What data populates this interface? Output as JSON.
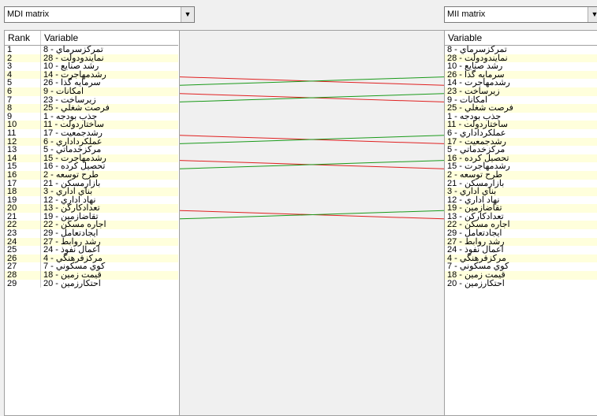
{
  "left_selector": {
    "value": "MDI matrix",
    "icon": "chevron-down-icon"
  },
  "right_selector": {
    "value": "MII matrix",
    "icon": "chevron-down-icon"
  },
  "left_table": {
    "headers": {
      "rank": "Rank",
      "variable": "Variable"
    },
    "rows": [
      {
        "rank": "1",
        "variable": "تمركزسرماي - 8"
      },
      {
        "rank": "2",
        "variable": "نمايندودولت - 28"
      },
      {
        "rank": "3",
        "variable": "رشد صنايع - 10"
      },
      {
        "rank": "4",
        "variable": "رشدمهاجرت - 14"
      },
      {
        "rank": "5",
        "variable": "سرمايه گذا - 26"
      },
      {
        "rank": "6",
        "variable": "امكانات - 9"
      },
      {
        "rank": "7",
        "variable": "زيرساخت - 23"
      },
      {
        "rank": "8",
        "variable": "فرصت شغلي - 25"
      },
      {
        "rank": "9",
        "variable": "جذب بودجه - 1"
      },
      {
        "rank": "10",
        "variable": "ساختاردولت - 11"
      },
      {
        "rank": "11",
        "variable": "رشدجمعيت - 17"
      },
      {
        "rank": "12",
        "variable": "عملكرداداري - 6"
      },
      {
        "rank": "13",
        "variable": "مركزخدماتي - 5"
      },
      {
        "rank": "14",
        "variable": "رشدمهاجرت - 15"
      },
      {
        "rank": "15",
        "variable": "تحصيل كرده - 16"
      },
      {
        "rank": "16",
        "variable": "طرح توسعه - 2"
      },
      {
        "rank": "17",
        "variable": "بازارمسكن - 21"
      },
      {
        "rank": "18",
        "variable": "بناي اداري - 3"
      },
      {
        "rank": "19",
        "variable": "نهاد اداري - 12"
      },
      {
        "rank": "20",
        "variable": "تعدادكاركن - 13"
      },
      {
        "rank": "21",
        "variable": "تقاضازمين - 19"
      },
      {
        "rank": "22",
        "variable": "اجاره مسكن - 22"
      },
      {
        "rank": "23",
        "variable": "ايجادتعامل - 29"
      },
      {
        "rank": "24",
        "variable": "رشد روابط - 27"
      },
      {
        "rank": "25",
        "variable": "اعمال نفوذ - 24"
      },
      {
        "rank": "26",
        "variable": "مركزفرهنگي - 4"
      },
      {
        "rank": "27",
        "variable": "كوي مسكوني - 7"
      },
      {
        "rank": "28",
        "variable": "قيمت زمين - 18"
      },
      {
        "rank": "29",
        "variable": "احتكارزمين - 20"
      }
    ]
  },
  "right_table": {
    "header": "Variable",
    "rows": [
      "تمركزسرماي - 8",
      "نمايندودولت - 28",
      "رشد صنايع - 10",
      "سرمايه گذا - 26",
      "رشدمهاجرت - 14",
      "زيرساخت - 23",
      "امكانات - 9",
      "فرصت شغلي - 25",
      "جذب بودجه - 1",
      "ساختاردولت - 11",
      "عملكرداداري - 6",
      "رشدجمعيت - 17",
      "مركزخدماتي - 5",
      "تحصيل كرده - 16",
      "رشدمهاجرت - 15",
      "طرح توسعه - 2",
      "بازارمسكن - 21",
      "بناي اداري - 3",
      "نهاد اداري - 12",
      "تقاضازمين - 19",
      "تعدادكاركن - 13",
      "اجاره مسكن - 22",
      "ايجادتعامل - 29",
      "رشد روابط - 27",
      "اعمال نفوذ - 24",
      "مركزفرهنگي - 4",
      "كوي مسكوني - 7",
      "قيمت زمين - 18",
      "احتكارزمين - 20"
    ]
  },
  "rank_changes": [
    {
      "from_rank": 4,
      "to_rank": 5,
      "color": "#e02020"
    },
    {
      "from_rank": 5,
      "to_rank": 4,
      "color": "#1a9a1a"
    },
    {
      "from_rank": 6,
      "to_rank": 7,
      "color": "#e02020"
    },
    {
      "from_rank": 7,
      "to_rank": 6,
      "color": "#1a9a1a"
    },
    {
      "from_rank": 11,
      "to_rank": 12,
      "color": "#e02020"
    },
    {
      "from_rank": 12,
      "to_rank": 11,
      "color": "#1a9a1a"
    },
    {
      "from_rank": 14,
      "to_rank": 15,
      "color": "#e02020"
    },
    {
      "from_rank": 15,
      "to_rank": 14,
      "color": "#1a9a1a"
    },
    {
      "from_rank": 20,
      "to_rank": 21,
      "color": "#e02020"
    },
    {
      "from_rank": 21,
      "to_rank": 20,
      "color": "#1a9a1a"
    }
  ],
  "colors": {
    "row_highlight": "#ffffdc",
    "row_plain": "#ffffff",
    "down": "#e02020",
    "up": "#1a9a1a"
  }
}
